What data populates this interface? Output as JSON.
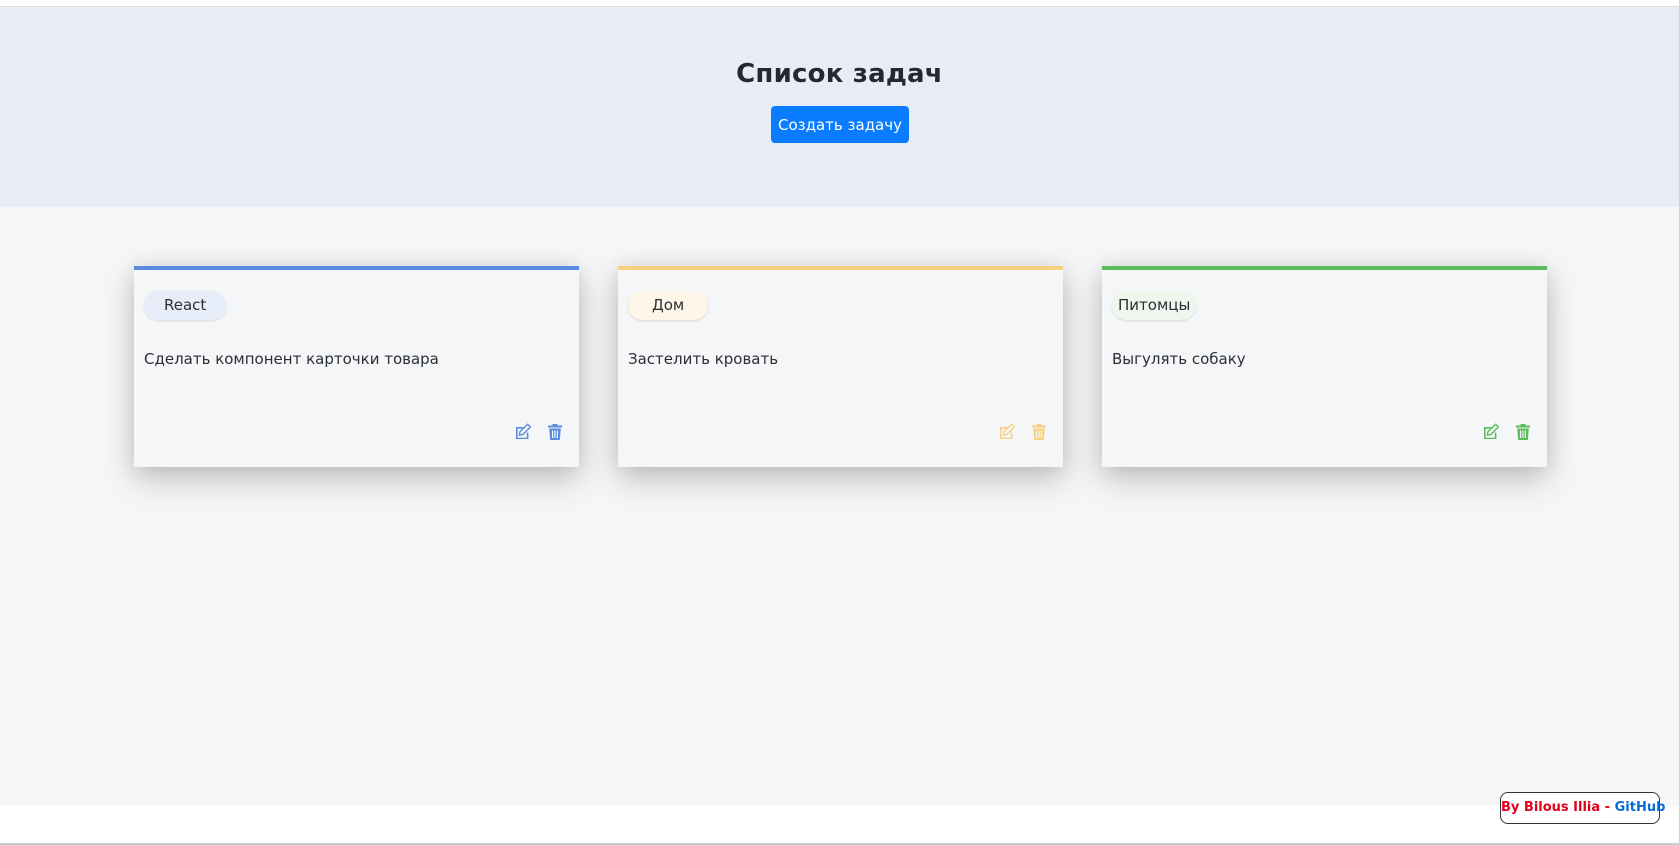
{
  "header": {
    "title": "Список задач",
    "create_button_label": "Создать задачу"
  },
  "cards": [
    {
      "tag": "React",
      "text": "Сделать компонент карточки товара",
      "accent": "#5b8bde",
      "tag_bg": "#e7eef9",
      "icons": [
        "edit-icon",
        "trash-icon"
      ]
    },
    {
      "tag": "Дом",
      "text": "Застелить кровать",
      "accent": "#f7d080",
      "tag_bg": "#fcf5e8",
      "icons": [
        "edit-icon",
        "trash-icon"
      ]
    },
    {
      "tag": "Питомцы",
      "text": "Выгулять собаку",
      "accent": "#5cbb5c",
      "tag_bg": "#eef6ee",
      "icons": [
        "edit-icon",
        "trash-icon"
      ]
    }
  ],
  "footer": {
    "credit_prefix": "By Bilous Illia - ",
    "credit_link": "GitHub"
  },
  "colors": {
    "header_bg": "#e8edf5",
    "main_bg": "#f4f6f8",
    "button_primary": "#0a7cff"
  }
}
